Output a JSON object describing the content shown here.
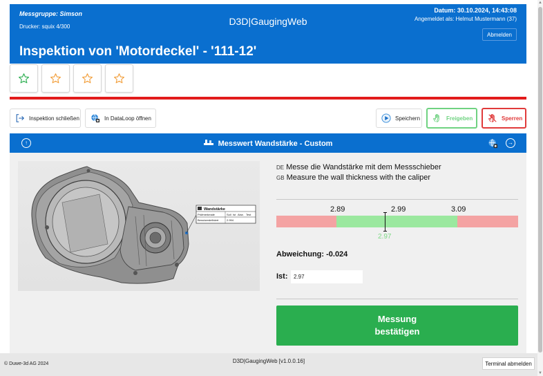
{
  "header": {
    "group": "Messgruppe: Simson",
    "printer": "Drucker: squix 4/300",
    "app_name": "D3D|GaugingWeb",
    "date": "Datum: 30.10.2024, 14:43:08",
    "user": "Angemeldet als: Helmut Mustermann (37)",
    "logout_label": "Abmelden",
    "title": "Inspektion von 'Motordeckel' - '111-12'"
  },
  "rating": {
    "stars": [
      {
        "icon": "star-outline-icon",
        "color": "#2aae4f"
      },
      {
        "icon": "star-outline-icon",
        "color": "#f29e3a"
      },
      {
        "icon": "star-outline-icon",
        "color": "#f29e3a"
      },
      {
        "icon": "star-outline-icon",
        "color": "#f29e3a"
      }
    ]
  },
  "actions": {
    "close_inspection": "Inspektion schließen",
    "open_dataloop": "In DataLoop öffnen",
    "save": "Speichern",
    "release": "Freigeben",
    "lock": "Sperren"
  },
  "measurement": {
    "title": "Messwert Wandstärke - Custom",
    "instruction_de_code": "DE",
    "instruction_de": "Messe die Wandstärke mit dem Messschieber",
    "instruction_gb_code": "GB",
    "instruction_gb": "Measure the wall thickness with the caliper",
    "gauge": {
      "lower_tol": "2.89",
      "nominal": "2.99",
      "upper_tol": "3.09",
      "actual": "2.97",
      "range": [
        2.8,
        3.18
      ],
      "actual_value": 2.97
    },
    "deviation_label": "Abweichung: -0.024",
    "actual_label": "Ist:",
    "actual_input": "2.97",
    "confirm_line1": "Messung",
    "confirm_line2": "bestätigen",
    "callout": {
      "title": "Wandstärke",
      "col1": "Prüfmerkmale",
      "col2": "Soll",
      "col3": "Ist",
      "col4": "Abw.",
      "col5": "Test",
      "row_label": "Benutzerdefiniert",
      "row_value": "2.994"
    }
  },
  "footer": {
    "copyright": "© Duwe-3d AG 2024",
    "version": "D3D|GaugingWeb [v1.0.0.16]",
    "terminal_logout": "Terminal abmelden"
  },
  "colors": {
    "primary": "#0a6fcf",
    "accent_red": "#e21b1b",
    "confirm_green": "#2aae4f",
    "tolerance_green": "#9be89f",
    "tolerance_red": "#f4a3a3"
  }
}
